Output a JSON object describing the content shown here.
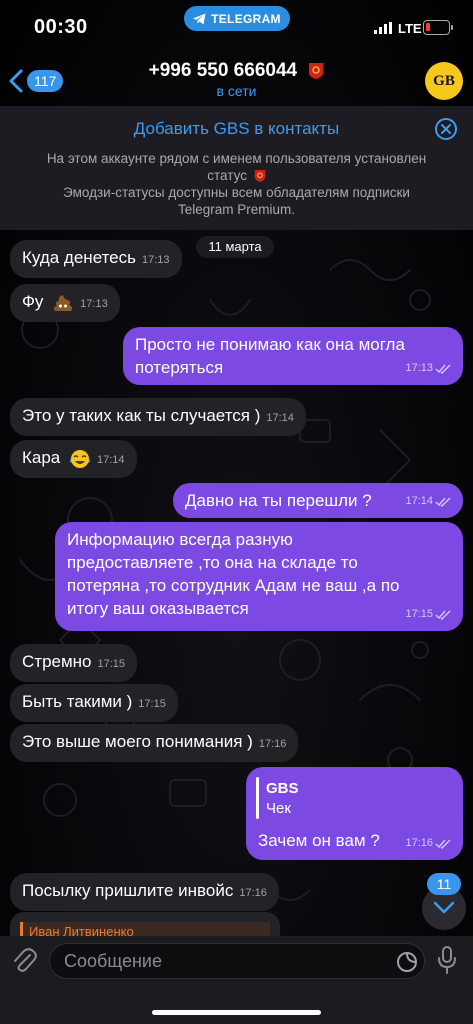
{
  "status_bar": {
    "time": "00:30",
    "app_pill": "TELEGRAM",
    "network": "LTE"
  },
  "header": {
    "back_count": "117",
    "title": "+996 550 666044",
    "subtitle": "в сети",
    "avatar_text": "GB"
  },
  "banner": {
    "title": "Добавить GBS в контакты",
    "text_line1": "На этом аккаунте рядом с именем пользователя установлен",
    "text_line2": "статус",
    "text_line3": "Эмодзи-статусы доступны всем обладателям подписки",
    "text_line4": "Telegram Premium."
  },
  "date_label": "11 марта",
  "messages": [
    {
      "direction": "in",
      "text": "Куда денетесь",
      "time": "17:13"
    },
    {
      "direction": "in",
      "text": "Фу",
      "emoji": "poop-emoji",
      "time": "17:13"
    },
    {
      "direction": "out",
      "line1": "Просто не понимаю как она могла",
      "line2": "потеряться",
      "time": "17:13"
    },
    {
      "direction": "in",
      "text": "Это у таких как ты случается )",
      "time": "17:14"
    },
    {
      "direction": "in",
      "text": "Кара",
      "emoji": "tears-of-joy-emoji",
      "time": "17:14"
    },
    {
      "direction": "out",
      "text": "Давно на ты перешли ?",
      "time": "17:14"
    },
    {
      "direction": "out",
      "line1": "Информацию всегда разную",
      "line2": "предоставляете ,то она на складе то",
      "line3": "потеряна ,то сотрудник Адам не ваш ,а по",
      "line4": "итогу ваш оказывается",
      "time": "17:15"
    },
    {
      "direction": "in",
      "text": "Стремно",
      "time": "17:15"
    },
    {
      "direction": "in",
      "text": "Быть такими )",
      "time": "17:15"
    },
    {
      "direction": "in",
      "text": "Это выше моего понимания )",
      "time": "17:16"
    },
    {
      "direction": "out",
      "reply_name": "GBS",
      "reply_text": "Чек",
      "text": "Зачем он вам ?",
      "time": "17:16"
    },
    {
      "direction": "in",
      "text": "Посылку пришлите инвойс",
      "time": "17:16"
    }
  ],
  "partial_quote": "Иван Литвиненко",
  "unread_count": "11",
  "composer": {
    "placeholder": "Сообщение"
  },
  "colors": {
    "outgoing_bubble": "#7c4ae3",
    "incoming_bubble": "#232227",
    "accent": "#3b9cf1"
  }
}
